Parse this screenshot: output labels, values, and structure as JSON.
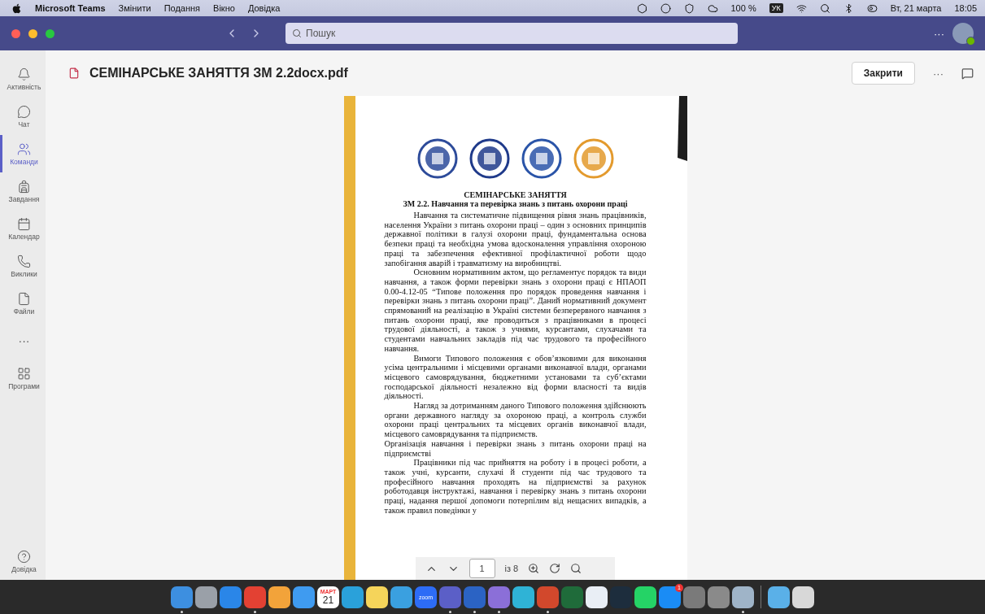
{
  "menu_bar": {
    "app": "Microsoft Teams",
    "menus": [
      "Змінити",
      "Подання",
      "Вікно",
      "Довідка"
    ],
    "battery": "100 %",
    "input_source": "УК",
    "date": "Вт, 21 марта",
    "time": "18:05"
  },
  "title_bar": {
    "search": {
      "placeholder": "Пошук"
    },
    "more": "···"
  },
  "sidebar": {
    "items": [
      {
        "label": "Активність",
        "kind": "bell",
        "selected": false
      },
      {
        "label": "Чат",
        "kind": "chat",
        "selected": false
      },
      {
        "label": "Команди",
        "kind": "teams",
        "selected": true
      },
      {
        "label": "Завдання",
        "kind": "backpack",
        "selected": false
      },
      {
        "label": "Календар",
        "kind": "calendar",
        "selected": false
      },
      {
        "label": "Виклики",
        "kind": "phone",
        "selected": false
      },
      {
        "label": "Файли",
        "kind": "file",
        "selected": false
      },
      {
        "label": "···",
        "kind": "more",
        "selected": false
      },
      {
        "label": "Програми",
        "kind": "apps",
        "selected": false
      }
    ],
    "help": {
      "label": "Довідка"
    }
  },
  "header": {
    "file_name": "СЕМІНАРСЬКЕ ЗАНЯТТЯ ЗМ 2.2docx.pdf",
    "close": "Закрити",
    "more": "···"
  },
  "document": {
    "title": "СЕМІНАРСЬКЕ ЗАНЯТТЯ",
    "subtitle": "ЗМ 2.2. Навчання та перевірка знань з питань охорони праці",
    "paragraphs": [
      {
        "kind": "indent",
        "text": "Навчання та систематичне підвищення рівня знань працівників, населення України з питань охорони праці – один з основних принципів державної політики в галузі охорони праці, фундаментальна основа безпеки праці та необхідна умова вдосконалення управління охороною праці та забезпечення ефективної профілактичної роботи щодо запобігання аварій і травматизму на виробництві."
      },
      {
        "kind": "indent",
        "text": "Основним нормативним актом, що регламентує порядок та види навчання, а також форми перевірки знань з охорони праці є НПАОП 0.00-4.12-05 “Типове положення про порядок проведення навчання і перевірки знань з питань охорони праці”. Даний нормативний документ спрямований на реалізацію в Україні системи безперервного навчання з питань охорони праці, яке проводиться з працівниками в процесі трудової діяльності, а також з учнями, курсантами, слухачами та студентами навчальних закладів під час трудового та професійного навчання."
      },
      {
        "kind": "indent",
        "text": "Вимоги Типового положення є обов’язковими для виконання усіма центральними і місцевими органами виконавчої влади, органами місцевого самоврядування, бюджетними установами та суб’єктами господарської діяльності незалежно від форми власності та видів діяльності."
      },
      {
        "kind": "indent",
        "text": "Нагляд за дотриманням даного Типового положення здійснюють органи державного нагляду за охороною праці, а контроль служби охорони праці центральних та місцевих органів виконавчої влади, місцевого самоврядування та підприємств."
      },
      {
        "kind": "plain",
        "text": "Організація навчання і перевірки знань з питань охорони праці на підприємстві"
      },
      {
        "kind": "indent",
        "text": "Працівники під час прийняття на роботу і в процесі роботи, а також учні, курсанти, слухачі й студенти під час трудового та професійного навчання проходять на підприємстві за рахунок роботодавця інструктажі, навчання і перевірку знань з питань охорони праці, надання першої допомоги потерпілим від нещасних випадків, а також правил поведінки у"
      }
    ]
  },
  "pdf_toolbar": {
    "page": "1",
    "of": "із 8"
  },
  "dock": {
    "items": [
      {
        "color": "#3d8fe0",
        "running": true
      },
      {
        "color": "#9aa0a8",
        "running": false
      },
      {
        "color": "#2a86e8",
        "running": false
      },
      {
        "color": "#e34133",
        "running": true
      },
      {
        "color": "#f2a33a",
        "running": false
      },
      {
        "color": "#3f9bf0",
        "running": false
      },
      {
        "color": "#ffffff",
        "running": false,
        "month": "МАРТ",
        "day": "21"
      },
      {
        "color": "#2aa1da",
        "running": false
      },
      {
        "color": "#f5d45a",
        "running": false
      },
      {
        "color": "#3aa0e0",
        "running": false
      },
      {
        "color": "#2d6cf6",
        "running": false,
        "label": "zoom"
      },
      {
        "color": "#5b5fc7",
        "running": true
      },
      {
        "color": "#2b63c4",
        "running": true
      },
      {
        "color": "#8b6fd8",
        "running": true
      },
      {
        "color": "#2fb3d6",
        "running": false
      },
      {
        "color": "#d2482c",
        "running": true
      },
      {
        "color": "#1f6b3a",
        "running": false
      },
      {
        "color": "#e9eef5",
        "running": false
      },
      {
        "color": "#1d2d3d",
        "running": false
      },
      {
        "color": "#25d366",
        "running": false
      },
      {
        "color": "#1a8cf5",
        "running": false,
        "badge": "1"
      },
      {
        "color": "#7a7a7a",
        "running": false
      },
      {
        "color": "#8a8a8a",
        "running": false
      },
      {
        "color": "#9fb4c8",
        "running": true
      }
    ],
    "extras": [
      {
        "color": "#5ab0e8",
        "running": false
      },
      {
        "color": "#d8d8d8",
        "running": false
      }
    ]
  }
}
